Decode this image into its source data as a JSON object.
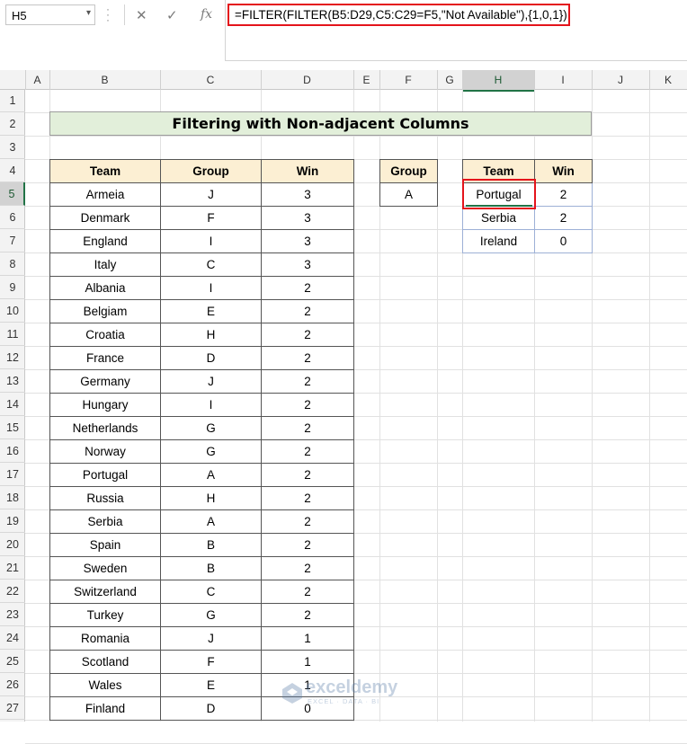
{
  "formula_bar": {
    "name_box": "H5",
    "cancel_icon": "✕",
    "enter_icon": "✓",
    "fx_label": "fx",
    "formula": "=FILTER(FILTER(B5:D29,C5:C29=F5,\"Not Available\"),{1,0,1})"
  },
  "columns": [
    "A",
    "B",
    "C",
    "D",
    "E",
    "F",
    "G",
    "H",
    "I",
    "J",
    "K"
  ],
  "selected_column": "H",
  "rows": [
    "1",
    "2",
    "3",
    "4",
    "5",
    "6",
    "7",
    "8",
    "9",
    "10",
    "11",
    "12",
    "13",
    "14",
    "15",
    "16",
    "17",
    "18",
    "19",
    "20",
    "21",
    "22",
    "23",
    "24",
    "25",
    "26",
    "27"
  ],
  "selected_row": "5",
  "title": "Filtering with Non-adjacent Columns",
  "main_table": {
    "headers": [
      "Team",
      "Group",
      "Win"
    ],
    "rows": [
      [
        "Armeia",
        "J",
        "3"
      ],
      [
        "Denmark",
        "F",
        "3"
      ],
      [
        "England",
        "I",
        "3"
      ],
      [
        "Italy",
        "C",
        "3"
      ],
      [
        "Albania",
        "I",
        "2"
      ],
      [
        "Belgiam",
        "E",
        "2"
      ],
      [
        "Croatia",
        "H",
        "2"
      ],
      [
        "France",
        "D",
        "2"
      ],
      [
        "Germany",
        "J",
        "2"
      ],
      [
        "Hungary",
        "I",
        "2"
      ],
      [
        "Netherlands",
        "G",
        "2"
      ],
      [
        "Norway",
        "G",
        "2"
      ],
      [
        "Portugal",
        "A",
        "2"
      ],
      [
        "Russia",
        "H",
        "2"
      ],
      [
        "Serbia",
        "A",
        "2"
      ],
      [
        "Spain",
        "B",
        "2"
      ],
      [
        "Sweden",
        "B",
        "2"
      ],
      [
        "Switzerland",
        "C",
        "2"
      ],
      [
        "Turkey",
        "G",
        "2"
      ],
      [
        "Romania",
        "J",
        "1"
      ],
      [
        "Scotland",
        "F",
        "1"
      ],
      [
        "Wales",
        "E",
        "1"
      ],
      [
        "Finland",
        "D",
        "0"
      ]
    ]
  },
  "group_table": {
    "header": "Group",
    "value": "A"
  },
  "result_table": {
    "headers": [
      "Team",
      "Win"
    ],
    "rows": [
      [
        "Portugal",
        "2"
      ],
      [
        "Serbia",
        "2"
      ],
      [
        "Ireland",
        "0"
      ]
    ]
  },
  "watermark": {
    "brand": "exceldemy",
    "tagline": "EXCEL · DATA · BI"
  }
}
